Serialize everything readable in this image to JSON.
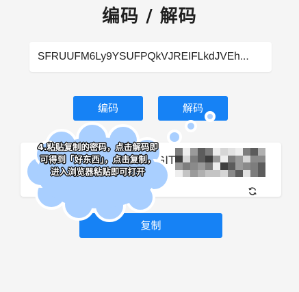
{
  "page": {
    "title": "编码 / 解码"
  },
  "input": {
    "value": "SFRUUFM6Ly9YSUFPQkVJREIFLkdJVEh..."
  },
  "buttons": {
    "encode": "编码",
    "decode": "解码",
    "copy": "复制"
  },
  "output": {
    "visible_text": "GIT",
    "suffix": "H"
  },
  "annotation": {
    "text": "4.粘贴复制的密码，点击解码即可得到「好东西」，点击复制，进入浏览器粘贴即可打开"
  },
  "colors": {
    "accent": "#1682f5",
    "bubble": "#a9cfff",
    "background": "#f5f5f5"
  },
  "icons": {
    "refresh": "refresh-icon"
  }
}
